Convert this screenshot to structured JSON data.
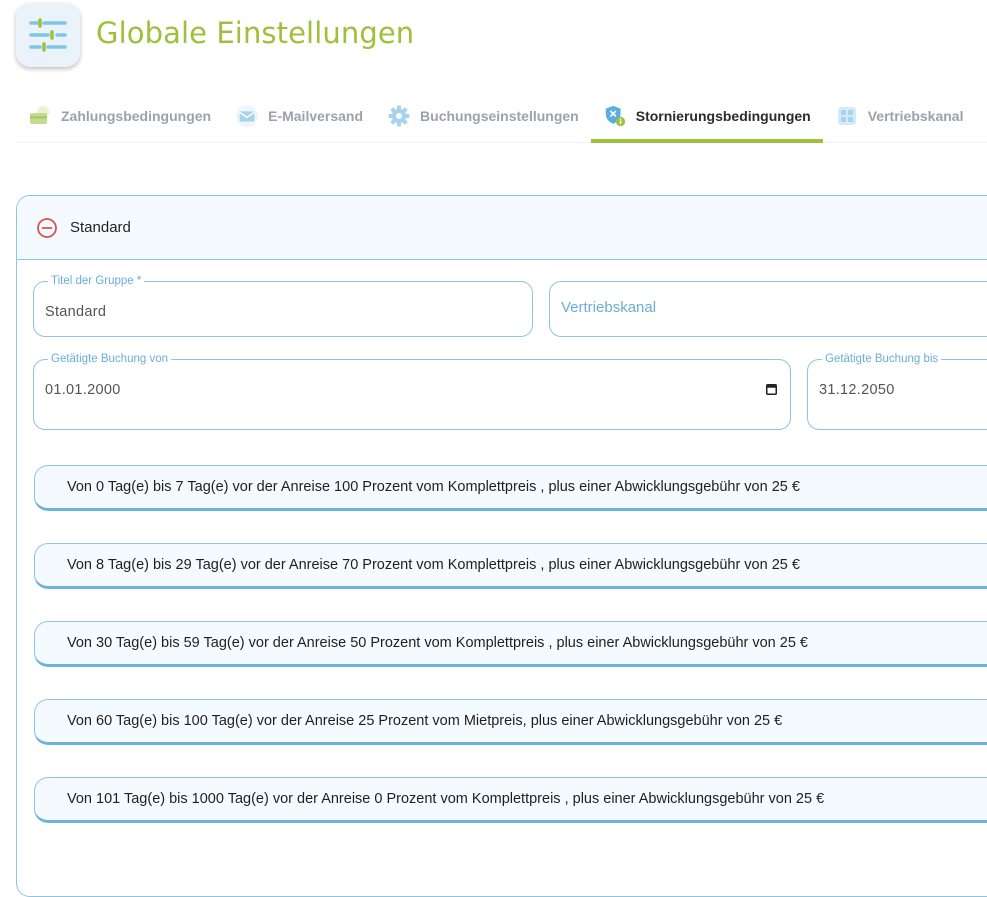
{
  "page": {
    "title": "Globale Einstellungen",
    "app_icon": "sliders-icon"
  },
  "tabs": [
    {
      "label": "Zahlungsbedingungen",
      "icon": "payment-card-icon",
      "active": false
    },
    {
      "label": "E-Mailversand",
      "icon": "envelope-icon",
      "active": false
    },
    {
      "label": "Buchungseinstellungen",
      "icon": "gear-icon",
      "active": false
    },
    {
      "label": "Stornierungsbedingungen",
      "icon": "shield-cancel-icon",
      "active": true
    },
    {
      "label": "Vertriebskanal",
      "icon": "grid-icon",
      "active": false
    }
  ],
  "group": {
    "header_title": "Standard",
    "collapse_icon": "minus-circle-icon",
    "fields": {
      "group_title": {
        "legend": "Titel der Gruppe *",
        "value": "Standard"
      },
      "sales_channel": {
        "placeholder": "Vertriebskanal"
      },
      "booking_from": {
        "legend": "Getätigte Buchung von",
        "value": "01.01.2000"
      },
      "booking_to": {
        "legend": "Getätigte Buchung bis",
        "value": "31.12.2050"
      }
    },
    "rules": [
      "Von 0 Tag(e) bis 7 Tag(e) vor der Anreise 100 Prozent vom Komplettpreis , plus einer Abwicklungsgebühr von 25 €",
      "Von 8 Tag(e) bis 29 Tag(e) vor der Anreise 70 Prozent vom Komplettpreis , plus einer Abwicklungsgebühr von 25 €",
      "Von 30 Tag(e) bis 59 Tag(e) vor der Anreise 50 Prozent vom Komplettpreis , plus einer Abwicklungsgebühr von 25 €",
      "Von 60 Tag(e) bis 100 Tag(e) vor der Anreise 25 Prozent vom Mietpreis, plus einer Abwicklungsgebühr von 25 €",
      "Von 101 Tag(e) bis 1000 Tag(e) vor der Anreise 0 Prozent vom Komplettpreis , plus einer Abwicklungsgebühr von 25 €"
    ]
  },
  "colors": {
    "brand_green": "#9ec03a",
    "accent_blue": "#8cc6e6",
    "collapse_red": "#d9534f"
  }
}
